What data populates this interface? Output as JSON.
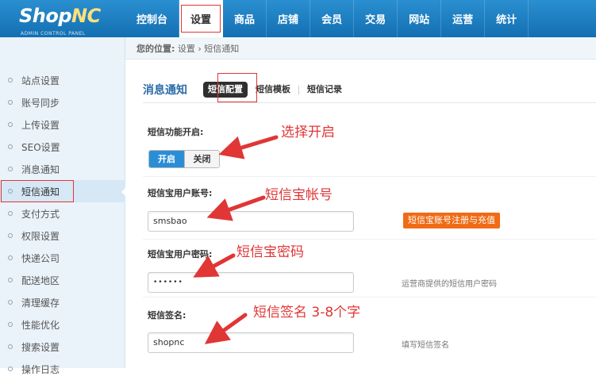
{
  "logo": {
    "shop": "Shop",
    "nc": "NC",
    "subtitle": "ADMIN CONTROL PANEL"
  },
  "nav": {
    "items": [
      {
        "label": "控制台",
        "active": false
      },
      {
        "label": "设置",
        "active": true
      },
      {
        "label": "商品",
        "active": false
      },
      {
        "label": "店铺",
        "active": false
      },
      {
        "label": "会员",
        "active": false
      },
      {
        "label": "交易",
        "active": false
      },
      {
        "label": "网站",
        "active": false
      },
      {
        "label": "运营",
        "active": false
      },
      {
        "label": "统计",
        "active": false
      }
    ]
  },
  "breadcrumb": {
    "prefix": "您的位置:",
    "path": "设置 › 短信通知"
  },
  "sidebar": {
    "items": [
      {
        "label": "站点设置"
      },
      {
        "label": "账号同步"
      },
      {
        "label": "上传设置"
      },
      {
        "label": "SEO设置"
      },
      {
        "label": "消息通知"
      },
      {
        "label": "短信通知",
        "active": true
      },
      {
        "label": "支付方式"
      },
      {
        "label": "权限设置"
      },
      {
        "label": "快递公司"
      },
      {
        "label": "配送地区"
      },
      {
        "label": "清理缓存"
      },
      {
        "label": "性能优化"
      },
      {
        "label": "搜索设置"
      },
      {
        "label": "操作日志"
      }
    ]
  },
  "tabs": {
    "title": "消息通知",
    "items": [
      {
        "label": "短信配置",
        "active": true
      },
      {
        "label": "短信模板"
      },
      {
        "label": "短信记录"
      }
    ]
  },
  "form": {
    "enable_label": "短信功能开启:",
    "toggle_on": "开启",
    "toggle_off": "关闭",
    "account_label": "短信宝用户账号:",
    "account_value": "smsbao",
    "register_button": "短信宝账号注册与充值",
    "password_label": "短信宝用户密码:",
    "password_value": "••••••",
    "password_hint": "运营商提供的短信用户密码",
    "sign_label": "短信签名:",
    "sign_value": "shopnc",
    "sign_hint": "填写短信签名"
  },
  "annotations": {
    "enable": "选择开启",
    "account": "短信宝帐号",
    "password": "短信宝密码",
    "sign_prefix": "短信签名",
    "sign_suffix": "3-8个字"
  },
  "colors": {
    "accent": "#2a8ed6",
    "annotation": "#e03636",
    "register": "#f06b16"
  }
}
